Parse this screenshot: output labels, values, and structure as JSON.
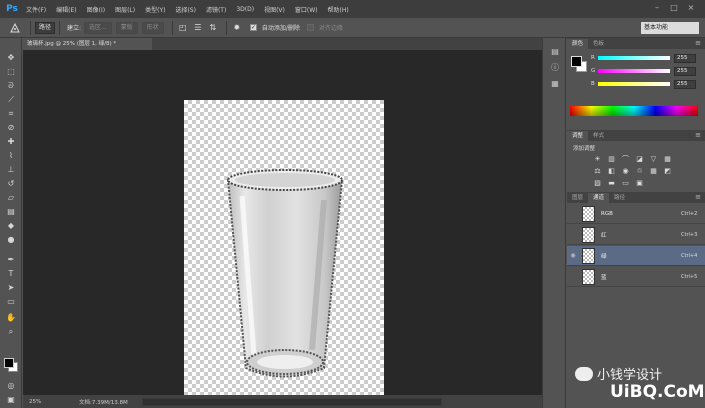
{
  "app": {
    "logo": "Ps"
  },
  "menu": [
    "文件(F)",
    "编辑(E)",
    "图像(I)",
    "图层(L)",
    "类型(Y)",
    "选择(S)",
    "滤镜(T)",
    "3D(D)",
    "视图(V)",
    "窗口(W)",
    "帮助(H)"
  ],
  "window_controls": [
    "–",
    "□",
    "×"
  ],
  "options": {
    "tool_icon": "pen-icon",
    "mode": "路径",
    "make_label": "建立:",
    "selection_btn": "选区...",
    "mask_btn": "蒙版",
    "shape_btn": "形状",
    "auto_add_delete": "自动添加/删除",
    "align_edges": "对齐边缘",
    "workspace": "基本功能"
  },
  "document": {
    "tab": "玻璃杯.jpg @ 25% (图层 1, 绿/8) *"
  },
  "status": {
    "zoom": "25%",
    "doc": "文档:7.39M/13.8M"
  },
  "color_panel": {
    "tabs": [
      "颜色",
      "色板"
    ],
    "channels": [
      {
        "label": "R",
        "value": "255"
      },
      {
        "label": "G",
        "value": "255"
      },
      {
        "label": "B",
        "value": "255"
      }
    ]
  },
  "adjustments_panel": {
    "tabs": [
      "调整",
      "样式"
    ],
    "title": "添加调整"
  },
  "channels_panel": {
    "tabs": [
      "图层",
      "通道",
      "路径"
    ],
    "rows": [
      {
        "name": "RGB",
        "shortcut": "Ctrl+2",
        "visible": true,
        "selected": false
      },
      {
        "name": "红",
        "shortcut": "Ctrl+3",
        "visible": false,
        "selected": false
      },
      {
        "name": "绿",
        "shortcut": "Ctrl+4",
        "visible": true,
        "selected": true
      },
      {
        "name": "蓝",
        "shortcut": "Ctrl+5",
        "visible": false,
        "selected": false
      }
    ]
  },
  "watermark": {
    "line1": "小钱学设计",
    "line2": "UiBQ.CoM"
  }
}
